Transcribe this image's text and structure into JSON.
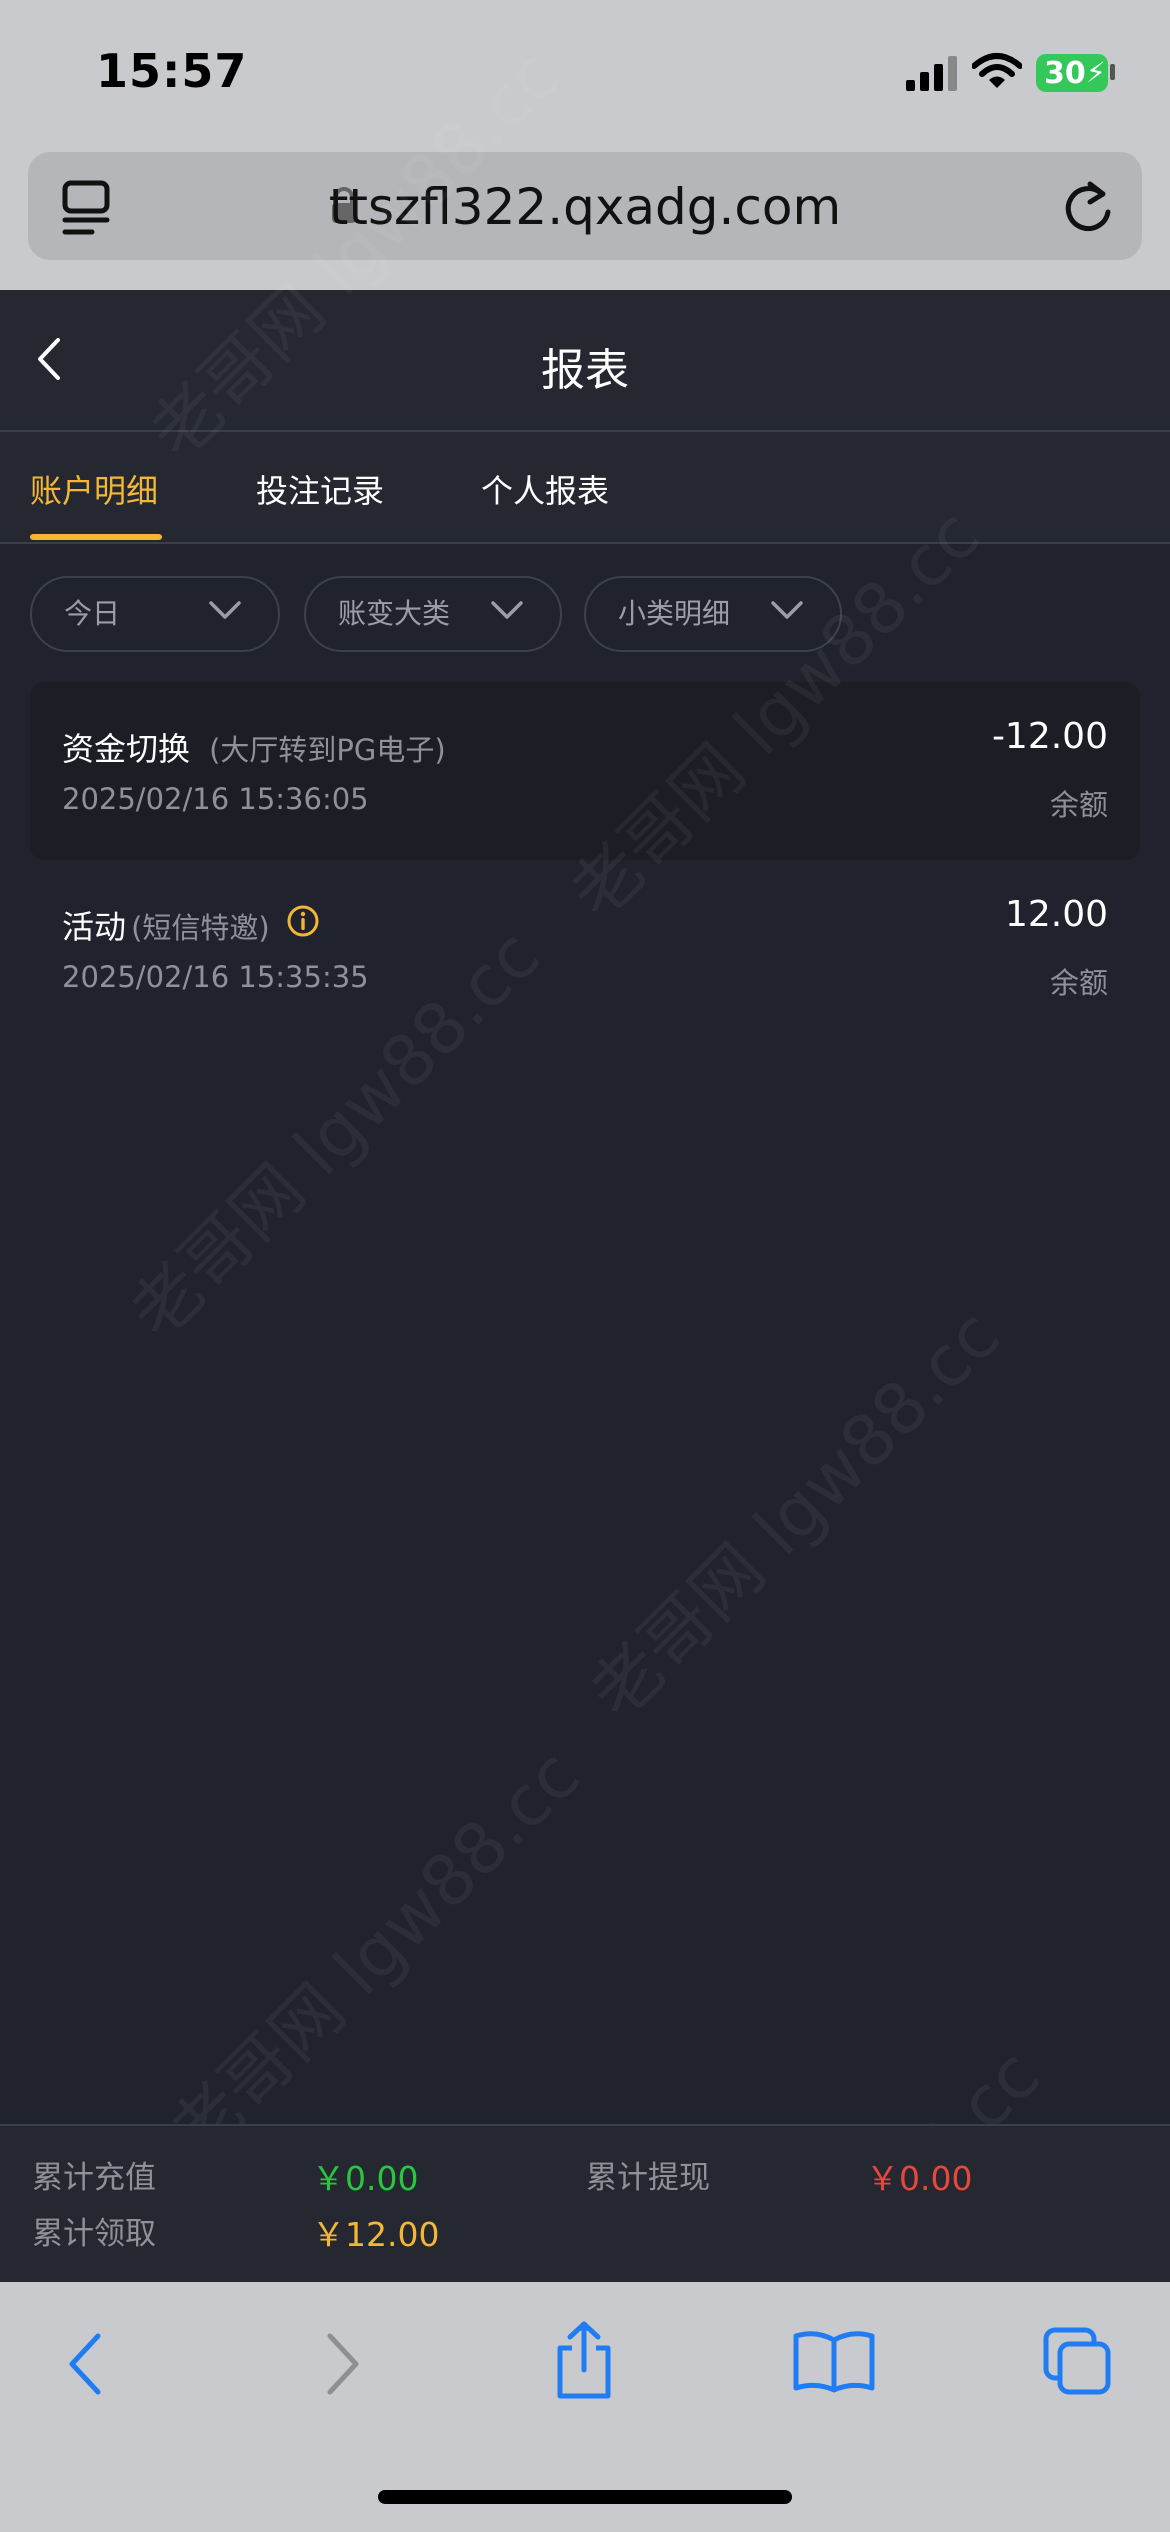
{
  "status_bar": {
    "time": "15:57",
    "battery": "30"
  },
  "browser": {
    "url": "ttszfl322.qxadg.com"
  },
  "header": {
    "title": "报表"
  },
  "tabs": [
    {
      "label": "账户明细",
      "active": true
    },
    {
      "label": "投注记录",
      "active": false
    },
    {
      "label": "个人报表",
      "active": false
    }
  ],
  "filters": [
    {
      "label": "今日"
    },
    {
      "label": "账变大类"
    },
    {
      "label": "小类明细"
    }
  ],
  "records": [
    {
      "title": "资金切换",
      "subtitle": "(大厅转到PG电子)",
      "datetime": "2025/02/16 15:36:05",
      "amount": "-12.00",
      "balance_label": "余额"
    },
    {
      "title": "活动",
      "subtitle": "(短信特邀)",
      "datetime": "2025/02/16 15:35:35",
      "amount": "12.00",
      "balance_label": "余额"
    }
  ],
  "summary": {
    "recharge_label": "累计充值",
    "recharge_value": "￥0.00",
    "withdraw_label": "累计提现",
    "withdraw_value": "￥0.00",
    "claim_label": "累计领取",
    "claim_value": "￥12.00"
  },
  "watermark": "老哥网 lgw88.cc",
  "colors": {
    "accent": "#f3b735",
    "green": "#27c840",
    "red": "#e8473e",
    "orange": "#f3b735",
    "ios_blue": "#1f7cf2"
  }
}
